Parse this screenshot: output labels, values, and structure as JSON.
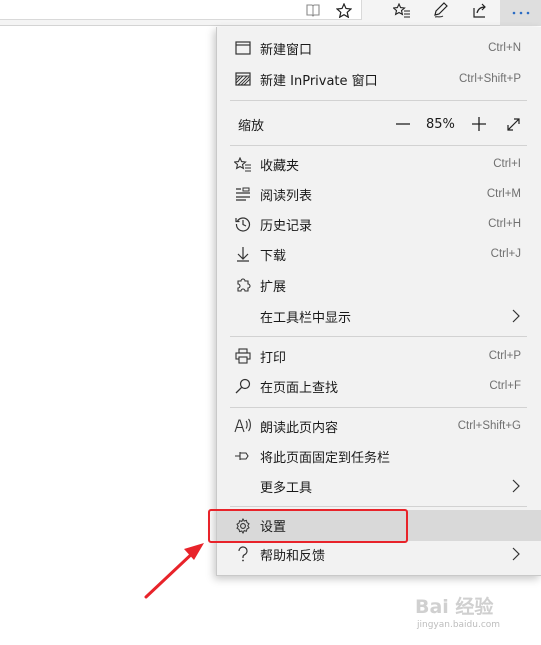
{
  "toolbar": {
    "icons": [
      "reading-view-icon",
      "favorite-star-icon",
      "favorites-list-icon",
      "pen-icon",
      "share-icon",
      "more-icon"
    ]
  },
  "menu": {
    "items": [
      {
        "label": "新建窗口",
        "shortcut": "Ctrl+N",
        "icon": "new-window-icon"
      },
      {
        "label": "新建 InPrivate 窗口",
        "shortcut": "Ctrl+Shift+P",
        "icon": "inprivate-window-icon"
      },
      {
        "label": "缩放",
        "zoom_value": "85%"
      },
      {
        "label": "收藏夹",
        "shortcut": "Ctrl+I",
        "icon": "favorites-icon"
      },
      {
        "label": "阅读列表",
        "shortcut": "Ctrl+M",
        "icon": "reading-list-icon"
      },
      {
        "label": "历史记录",
        "shortcut": "Ctrl+H",
        "icon": "history-icon"
      },
      {
        "label": "下载",
        "shortcut": "Ctrl+J",
        "icon": "download-icon"
      },
      {
        "label": "扩展",
        "icon": "extensions-icon"
      },
      {
        "label": "在工具栏中显示",
        "submenu": true
      },
      {
        "label": "打印",
        "shortcut": "Ctrl+P",
        "icon": "print-icon"
      },
      {
        "label": "在页面上查找",
        "shortcut": "Ctrl+F",
        "icon": "find-icon"
      },
      {
        "label": "朗读此页内容",
        "shortcut": "Ctrl+Shift+G",
        "icon": "read-aloud-icon"
      },
      {
        "label": "将此页面固定到任务栏",
        "icon": "pin-icon"
      },
      {
        "label": "更多工具",
        "submenu": true
      },
      {
        "label": "设置",
        "icon": "settings-gear-icon",
        "highlighted": true
      },
      {
        "label": "帮助和反馈",
        "icon": "help-icon",
        "submenu": true
      }
    ]
  },
  "annotation": {
    "color": "#e8232a"
  },
  "watermark": {
    "main": "Bai 经验",
    "sub": "jingyan.baidu.com"
  }
}
